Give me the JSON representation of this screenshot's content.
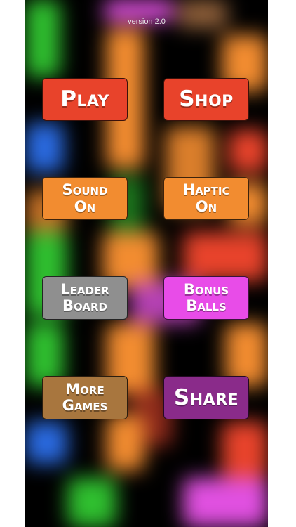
{
  "version": "version 2.0",
  "colors": {
    "play": "#e8432b",
    "shop": "#e8432b",
    "sound": "#f28c30",
    "haptic": "#f28c30",
    "leaderboard": "#8f8f8f",
    "bonus": "#e84ce8",
    "more_games": "#a8763e",
    "share": "#8a2b8a"
  },
  "buttons": {
    "play": "Play",
    "shop": "Shop",
    "sound": {
      "line1": "Sound",
      "line2": "On"
    },
    "haptic": {
      "line1": "Haptic",
      "line2": "On"
    },
    "leaderboard": {
      "line1": "Leader",
      "line2": "Board"
    },
    "bonus_balls": {
      "line1": "Bonus",
      "line2": "Balls"
    },
    "more_games": {
      "line1": "More",
      "line2": "Games"
    },
    "share": "Share"
  }
}
